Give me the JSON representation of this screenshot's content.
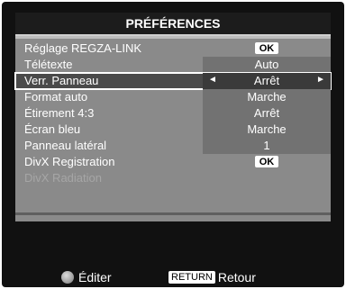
{
  "title": "PRÉFÉRENCES",
  "rows": [
    {
      "label": "Réglage REGZA-LINK",
      "value": "OK",
      "type": "button"
    },
    {
      "label": "Télétexte",
      "value": "Auto",
      "type": "value"
    },
    {
      "label": "Verr. Panneau",
      "value": "Arrêt",
      "type": "selector"
    },
    {
      "label": "Format auto",
      "value": "Marche",
      "type": "value"
    },
    {
      "label": "Étirement 4:3",
      "value": "Arrêt",
      "type": "value"
    },
    {
      "label": "Écran bleu",
      "value": "Marche",
      "type": "value"
    },
    {
      "label": "Panneau latéral",
      "value": "1",
      "type": "value"
    },
    {
      "label": "DivX Registration",
      "value": "OK",
      "type": "button"
    },
    {
      "label": "DivX Radiation",
      "value": "",
      "type": "disabled"
    }
  ],
  "footer": {
    "edit_label": "Éditer",
    "return_key": "RETURN",
    "return_label": "Retour"
  },
  "icons": {
    "left_arrow": "◄",
    "right_arrow": "►"
  }
}
